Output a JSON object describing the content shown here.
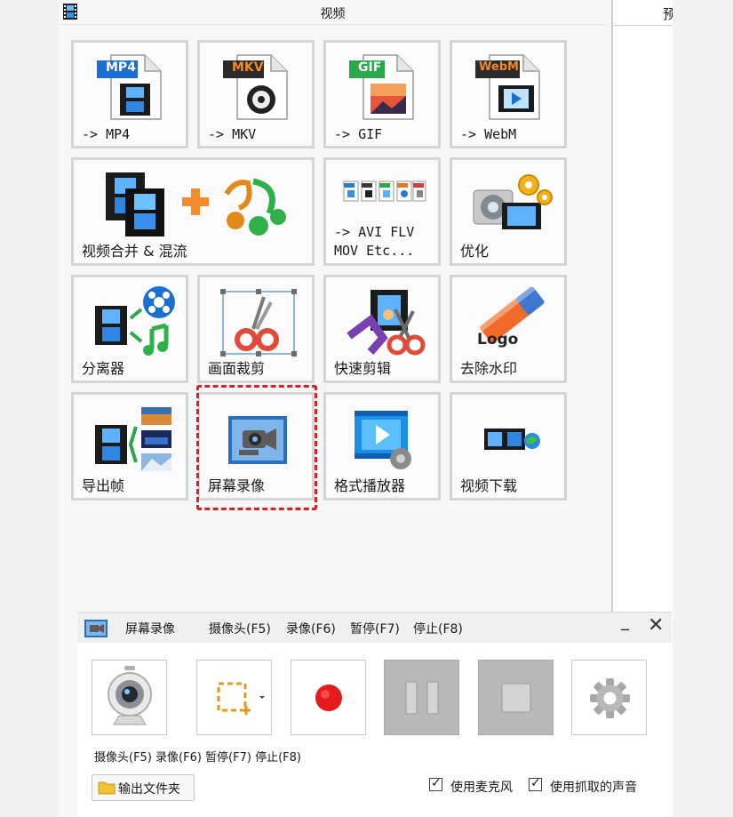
{
  "window": {
    "title": "视频",
    "right_partial_char": "预"
  },
  "tiles": [
    {
      "label": "-> MP4",
      "badge": "MP4",
      "badge_color": "#1b6fd0"
    },
    {
      "label": "-> MKV",
      "badge": "MKV",
      "badge_color": "#d8661c"
    },
    {
      "label": "-> GIF",
      "badge": "GIF",
      "badge_color": "#2aa84a"
    },
    {
      "label": "-> WebM",
      "badge": "WebM",
      "badge_color": "#e07a1a"
    },
    {
      "label": "视频合并 & 混流"
    },
    {
      "label": "-> AVI FLV\nMOV Etc..."
    },
    {
      "label": "优化"
    },
    {
      "label": "分离器"
    },
    {
      "label": "画面裁剪"
    },
    {
      "label": "快速剪辑"
    },
    {
      "label": "去除水印",
      "logo_text": "Logo"
    },
    {
      "label": "导出帧"
    },
    {
      "label": "屏幕录像"
    },
    {
      "label": "格式播放器"
    },
    {
      "label": "视频下载"
    }
  ],
  "recorder": {
    "title": "屏幕录像",
    "cam": "摄像头(F5)",
    "rec": "录像(F6)",
    "pause": "暂停(F7)",
    "stop": "停止(F8)",
    "minimize": "_",
    "close": "✕",
    "hint": "摄像头(F5) 录像(F6) 暂停(F7) 停止(F8)",
    "output_folder": "输出文件夹",
    "use_mic": "使用麦克风",
    "use_captured_sound": "使用抓取的声音",
    "use_mic_checked": true,
    "use_captured_checked": true,
    "check_mark": "✓"
  },
  "colors": {
    "highlight": "#d6232b",
    "record_red": "#e41b1b",
    "disabled_gray": "#b9b9b9"
  }
}
